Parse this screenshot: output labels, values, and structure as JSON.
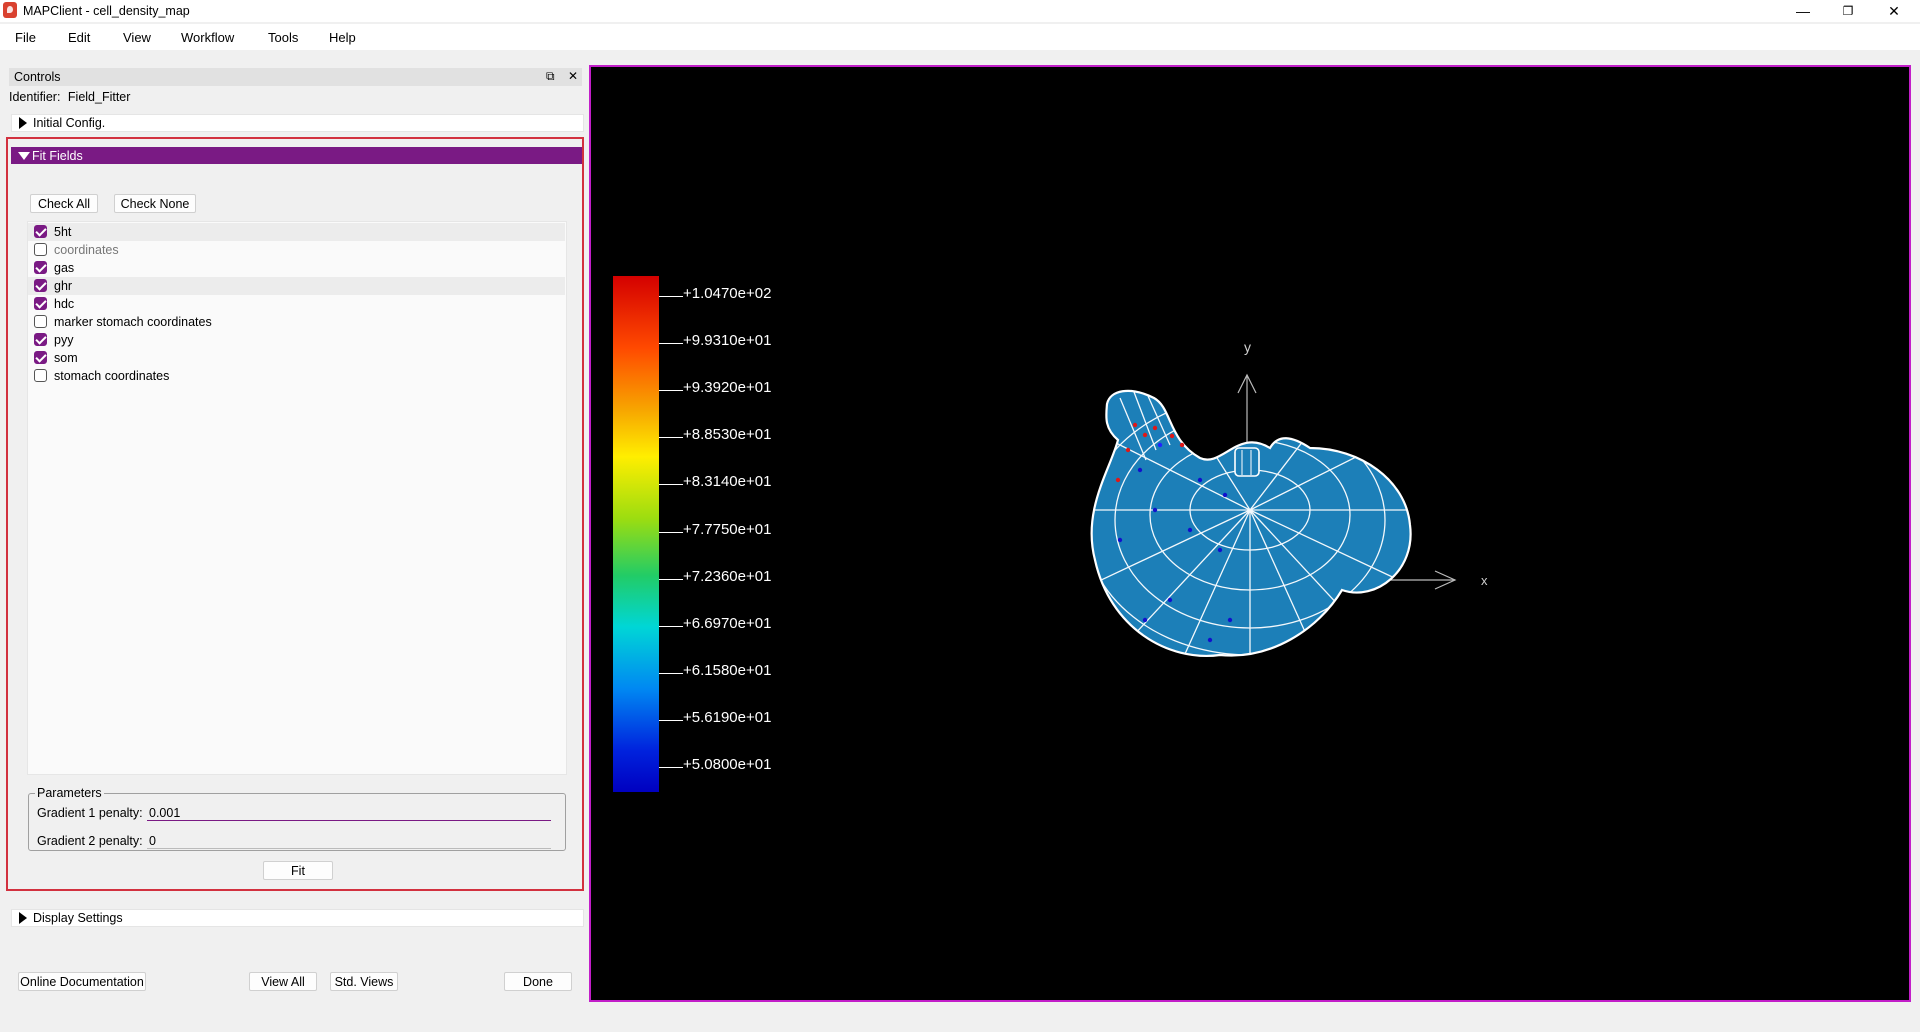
{
  "window": {
    "title": "MAPClient - cell_density_map",
    "controls": {
      "minimize": "—",
      "maximize": "❐",
      "close": "✕"
    }
  },
  "menu": [
    "File",
    "Edit",
    "View",
    "Workflow",
    "Tools",
    "Help"
  ],
  "dock": {
    "title": "Controls",
    "float_icon": "⧉",
    "close_icon": "✕",
    "identifier_label": "Identifier:",
    "identifier_value": "Field_Fitter"
  },
  "sections": {
    "initial_config": "Initial Config.",
    "fit_fields": "Fit Fields",
    "display_settings": "Display Settings"
  },
  "fit": {
    "check_all": "Check All",
    "check_none": "Check None",
    "fields": [
      {
        "label": "5ht",
        "checked": true,
        "dim": false,
        "highlight": true
      },
      {
        "label": "coordinates",
        "checked": false,
        "dim": true,
        "highlight": false
      },
      {
        "label": "gas",
        "checked": true,
        "dim": false,
        "highlight": false
      },
      {
        "label": "ghr",
        "checked": true,
        "dim": false,
        "highlight": true
      },
      {
        "label": "hdc",
        "checked": true,
        "dim": false,
        "highlight": false
      },
      {
        "label": "marker stomach coordinates",
        "checked": false,
        "dim": false,
        "highlight": false
      },
      {
        "label": "pyy",
        "checked": true,
        "dim": false,
        "highlight": false
      },
      {
        "label": "som",
        "checked": true,
        "dim": false,
        "highlight": false
      },
      {
        "label": "stomach coordinates",
        "checked": false,
        "dim": false,
        "highlight": false
      }
    ],
    "parameters_title": "Parameters",
    "gradient1_label": "Gradient 1 penalty:",
    "gradient1_value": "0.001",
    "gradient2_label": "Gradient 2 penalty:",
    "gradient2_value": "0",
    "fit_button": "Fit"
  },
  "footer": {
    "online_docs": "Online Documentation",
    "view_all": "View All",
    "std_views": "Std. Views",
    "done": "Done"
  },
  "viewer": {
    "colorbar_labels": [
      "+1.0470e+02",
      "+9.9310e+01",
      "+9.3920e+01",
      "+8.8530e+01",
      "+8.3140e+01",
      "+7.7750e+01",
      "+7.2360e+01",
      "+6.6970e+01",
      "+6.1580e+01",
      "+5.6190e+01",
      "+5.0800e+01"
    ],
    "axis_x": "x",
    "axis_y": "y",
    "mesh_color": "#1c7fb8",
    "border_color": "#c21ec9"
  }
}
